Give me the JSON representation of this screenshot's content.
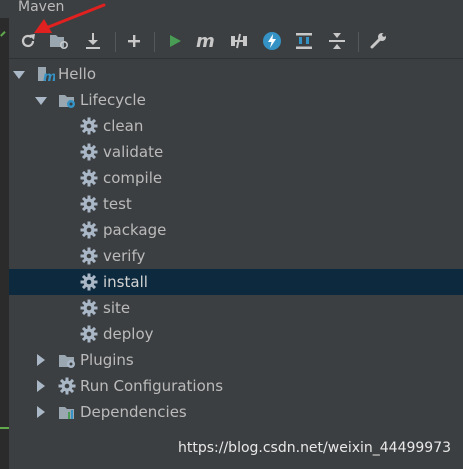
{
  "window": {
    "title": "Maven"
  },
  "toolbar": {
    "buttons": [
      {
        "name": "reload-all-icon"
      },
      {
        "name": "generate-sources-icon"
      },
      {
        "name": "download-icon"
      },
      {
        "name": "add-icon"
      },
      {
        "name": "run-icon"
      },
      {
        "name": "execute-goal-icon"
      },
      {
        "name": "toggle-offline-icon"
      },
      {
        "name": "skip-tests-icon"
      },
      {
        "name": "show-dependencies-icon"
      },
      {
        "name": "collapse-all-icon"
      },
      {
        "name": "settings-wrench-icon"
      }
    ]
  },
  "tree": {
    "project": "Hello",
    "lifecycle": {
      "label": "Lifecycle",
      "goals": [
        "clean",
        "validate",
        "compile",
        "test",
        "package",
        "verify",
        "install",
        "site",
        "deploy"
      ],
      "selected": "install"
    },
    "plugins": "Plugins",
    "run_configurations": "Run Configurations",
    "dependencies": "Dependencies"
  },
  "watermark": "https://blog.csdn.net/weixin_44499973",
  "colors": {
    "background": "#3c3f41",
    "selection": "#0d293e",
    "run_green": "#499c54",
    "accent_blue": "#3592c4"
  }
}
